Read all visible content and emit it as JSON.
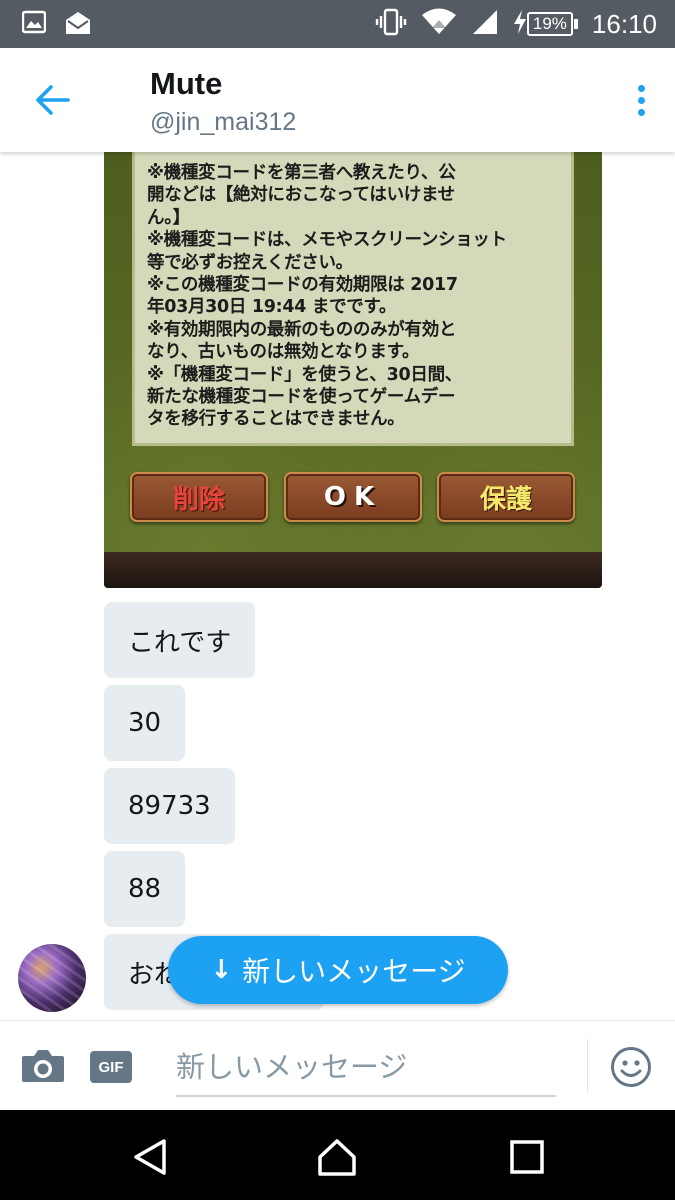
{
  "status_bar": {
    "time": "16:10",
    "battery": "19%",
    "icons": [
      "gallery-icon",
      "email-icon",
      "vibrate-icon",
      "wifi-icon",
      "signal-icon",
      "charging-icon"
    ]
  },
  "header": {
    "title": "Mute",
    "handle": "@jin_mai312"
  },
  "attachment": {
    "lines": [
      "※機種変コードを第三者へ教えたり、公",
      "開などは【絶対におこなってはいけませ",
      "ん。】",
      "※機種変コードは、メモやスクリーンショット",
      "等で必ずお控えください。",
      "※この機種変コードの有効期限は 2017",
      "年03月30日 19:44 までです。",
      "※有効期限内の最新のもののみが有効と",
      "なり、古いものは無効となります。",
      "※「機種変コード」を使うと、30日間、",
      "新たな機種変コードを使ってゲームデー",
      "タを移行することはできません。"
    ],
    "buttons": {
      "delete": "削除",
      "ok": "OK",
      "protect": "保護"
    }
  },
  "messages": [
    {
      "text": "これです"
    },
    {
      "text": "30"
    },
    {
      "text": "89733"
    },
    {
      "text": "88"
    },
    {
      "text": "おね"
    }
  ],
  "new_messages_pill": {
    "arrow": "↓",
    "label": "新しいメッセージ"
  },
  "compose": {
    "gif_label": "GIF",
    "placeholder": "新しいメッセージ"
  },
  "colors": {
    "accent": "#1da1f2",
    "bubble": "#e6ecf0",
    "status_bar": "#555b63"
  }
}
